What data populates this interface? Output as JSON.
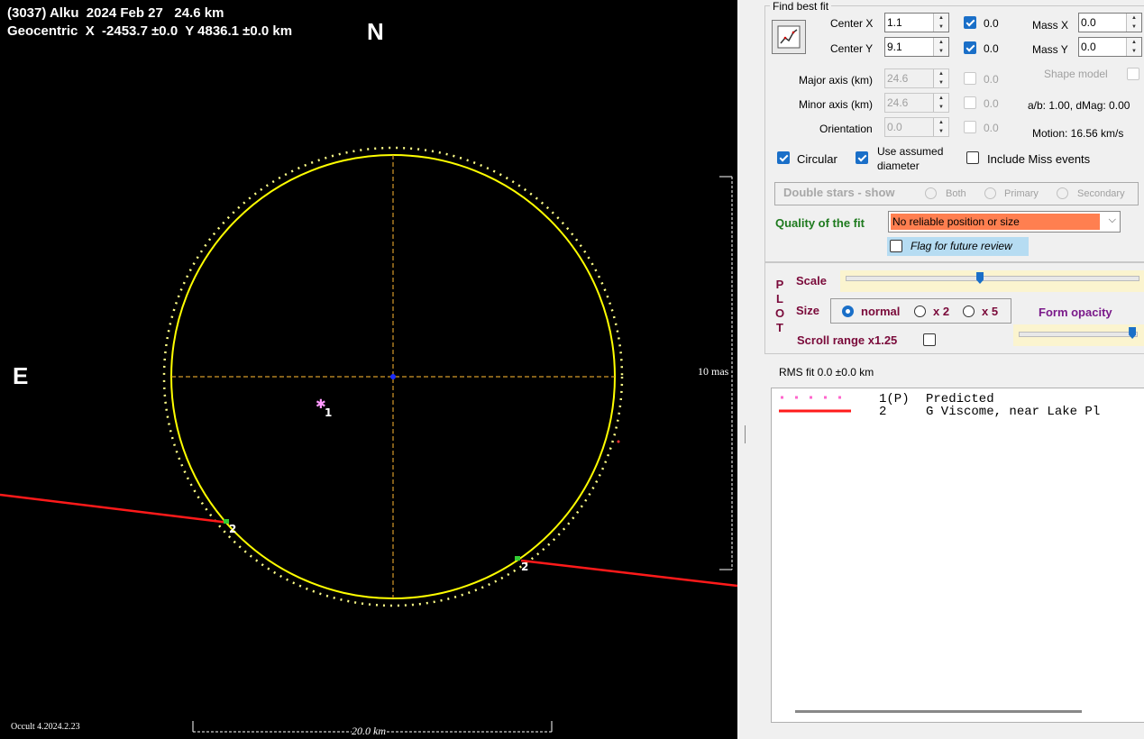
{
  "plot": {
    "title_line1": "(3037) Alku  2024 Feb 27   24.6 km",
    "title_line2": "Geocentric  X  -2453.7 ±0.0  Y 4836.1 ±0.0 km",
    "north_label": "N",
    "east_label": "E",
    "scale_label": "10 mas",
    "distance_label": "20.0 km",
    "version_label": "Occult 4.2024.2.23",
    "point_label_1": "1",
    "chord_label_a": "2",
    "chord_label_b": "2",
    "colors": {
      "background": "#000000",
      "ellipse": "#ffff00",
      "chord": "#ff0000",
      "axes": "#d49a2a"
    }
  },
  "fit": {
    "group_title": "Find best fit",
    "fit_button_icon": "graph-fit-icon",
    "center_x_label": "Center X",
    "center_x_value": "1.1",
    "center_x_check": "0.0",
    "center_y_label": "Center Y",
    "center_y_value": "9.1",
    "center_y_check": "0.0",
    "mass_x_label": "Mass X",
    "mass_x_value": "0.0",
    "mass_y_label": "Mass Y",
    "mass_y_value": "0.0",
    "shape_model_label": "Shape model",
    "major_label": "Major axis (km)",
    "major_value": "24.6",
    "major_check": "0.0",
    "minor_label": "Minor axis (km)",
    "minor_value": "24.6",
    "minor_check": "0.0",
    "orient_label": "Orientation",
    "orient_value": "0.0",
    "orient_check": "0.0",
    "ab_text": "a/b: 1.00, dMag: 0.00",
    "motion_text": "Motion: 16.56 km/s",
    "circular_label": "Circular",
    "use_assumed_label_1": "Use assumed",
    "use_assumed_label_2": "diameter",
    "include_miss_label": "Include Miss events",
    "double_stars_label": "Double stars - show",
    "radio_both": "Both",
    "radio_primary": "Primary",
    "radio_secondary": "Secondary",
    "quality_label": "Quality of the fit",
    "quality_value": "No reliable position or size",
    "quality_color": "#ff7f50",
    "flag_label": "Flag for future review"
  },
  "plotctl": {
    "plot_letters": [
      "P",
      "L",
      "O",
      "T"
    ],
    "scale_label": "Scale",
    "scale_value": 0.46,
    "size_label": "Size",
    "size_normal": "normal",
    "size_x2": "x 2",
    "size_x5": "x 5",
    "form_opacity_label": "Form opacity",
    "opacity_value": 0.97,
    "scroll_range_label": "Scroll range x1.25"
  },
  "rms": {
    "label": "RMS fit 0.0 ±0.0 km"
  },
  "legend": {
    "rows": [
      {
        "num": "1(P)",
        "text": "Predicted"
      },
      {
        "num": "2",
        "text": "G Viscome, near Lake Pl"
      }
    ]
  }
}
